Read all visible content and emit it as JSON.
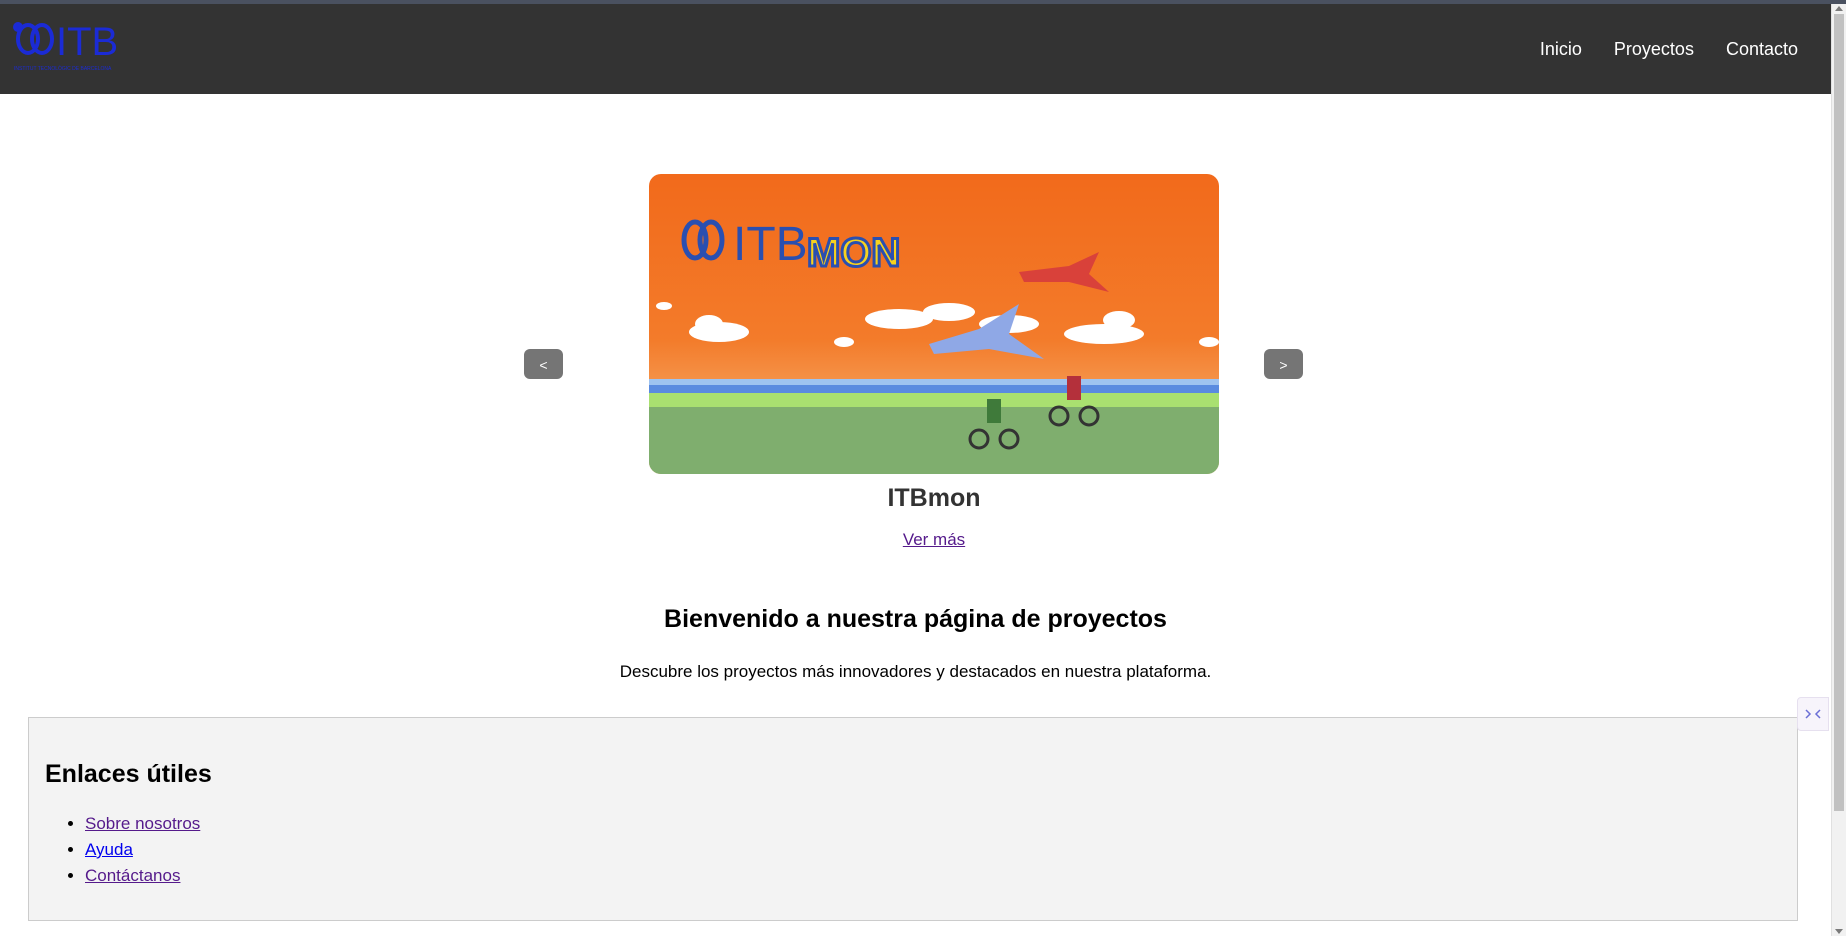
{
  "header": {
    "logo_text": "ITB",
    "logo_tagline": "INSTITUT TECNOLÒGIC DE BARCELONA",
    "nav": [
      {
        "label": "Inicio"
      },
      {
        "label": "Proyectos"
      },
      {
        "label": "Contacto"
      }
    ]
  },
  "carousel": {
    "prev_label": "<",
    "next_label": ">",
    "slide": {
      "banner_logo_text": "ITB",
      "banner_brand_text": "MON",
      "title": "ITBmon",
      "link_label": "Ver más"
    }
  },
  "welcome": {
    "title": "Bienvenido a nuestra página de proyectos",
    "text": "Descubre los proyectos más innovadores y destacados en nuestra plataforma."
  },
  "useful_links": {
    "title": "Enlaces útiles",
    "items": [
      {
        "label": "Sobre nosotros"
      },
      {
        "label": "Ayuda"
      },
      {
        "label": "Contáctanos"
      }
    ]
  },
  "colors": {
    "header_bg": "#333333",
    "logo_blue": "#1b2bd6",
    "banner_orange": "#f26a1b",
    "carousel_button": "#757575",
    "visited_link": "#551a8b",
    "link": "#0000ee"
  }
}
